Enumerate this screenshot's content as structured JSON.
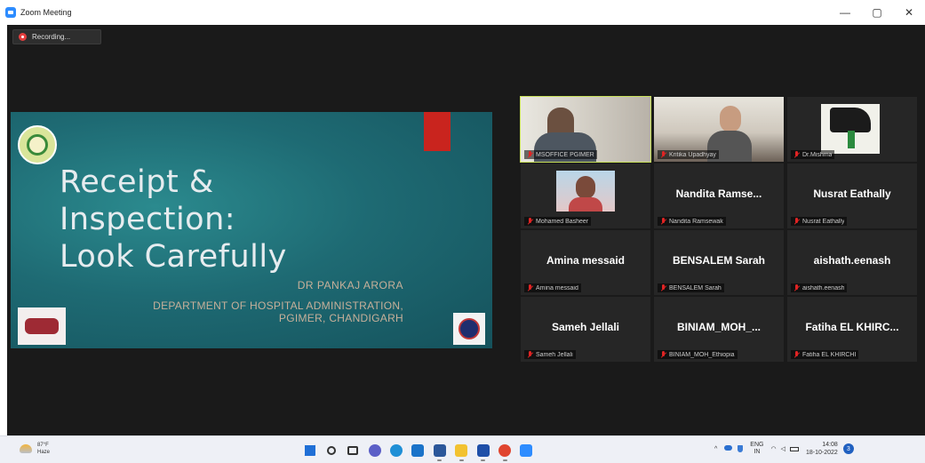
{
  "window": {
    "title": "Zoom Meeting",
    "controls": {
      "minimize": "—",
      "restore": "▢",
      "close": "✕"
    }
  },
  "recording": {
    "label": "Recording..."
  },
  "slide": {
    "title": "Receipt &\nInspection:\nLook Carefully",
    "author": "DR PANKAJ ARORA",
    "department": "DEPARTMENT OF HOSPITAL ADMINISTRATION,\nPGIMER, CHANDIGARH"
  },
  "participants": [
    {
      "display": "",
      "label": "MSOFFICE PGIMER",
      "video": true,
      "active": true
    },
    {
      "display": "",
      "label": "Kritika Upadhyay",
      "video": true,
      "active": false
    },
    {
      "display": "",
      "label": "Dr.Mishma",
      "video": true,
      "active": false
    },
    {
      "display": "",
      "label": "Mohamed Basheer",
      "video": true,
      "active": false
    },
    {
      "display": "Nandita  Ramse...",
      "label": "Nandita Ramsewak",
      "video": false,
      "active": false
    },
    {
      "display": "Nusrat Eathally",
      "label": "Nusrat Eathally",
      "video": false,
      "active": false
    },
    {
      "display": "Amina messaid",
      "label": "Amina messaid",
      "video": false,
      "active": false
    },
    {
      "display": "BENSALEM Sarah",
      "label": "BENSALEM Sarah",
      "video": false,
      "active": false
    },
    {
      "display": "aishath.eenash",
      "label": "aishath.eenash",
      "video": false,
      "active": false
    },
    {
      "display": "Sameh Jellali",
      "label": "Sameh Jellali",
      "video": false,
      "active": false
    },
    {
      "display": "BINIAM_MOH_...",
      "label": "BINIAM_MOH_Ethiopia",
      "video": false,
      "active": false
    },
    {
      "display": "Fatiha EL KHIRC...",
      "label": "Fatiha EL KHIRCHI",
      "video": false,
      "active": false
    }
  ],
  "taskbar": {
    "weather": {
      "temp": "87°F",
      "condition": "Haze"
    },
    "apps": [
      {
        "name": "start-icon",
        "color": "#1f6fd6"
      },
      {
        "name": "search-icon",
        "color": "#333333"
      },
      {
        "name": "task-view-icon",
        "color": "#333333"
      },
      {
        "name": "chat-icon",
        "color": "#5b5fc7"
      },
      {
        "name": "edge-icon",
        "color": "#1f8fd6"
      },
      {
        "name": "mail-icon",
        "color": "#1a73c9"
      },
      {
        "name": "word-icon",
        "color": "#2b579a"
      },
      {
        "name": "file-explorer-icon",
        "color": "#f2c230"
      },
      {
        "name": "photos-icon",
        "color": "#1e4fa8"
      },
      {
        "name": "chrome-icon",
        "color": "#e0452f"
      },
      {
        "name": "zoom-icon",
        "color": "#2d8cff"
      }
    ],
    "tray": {
      "chevron": "^",
      "lang_line1": "ENG",
      "lang_line2": "IN",
      "time": "14:08",
      "date": "18-10-2022",
      "notifications": "3"
    }
  }
}
